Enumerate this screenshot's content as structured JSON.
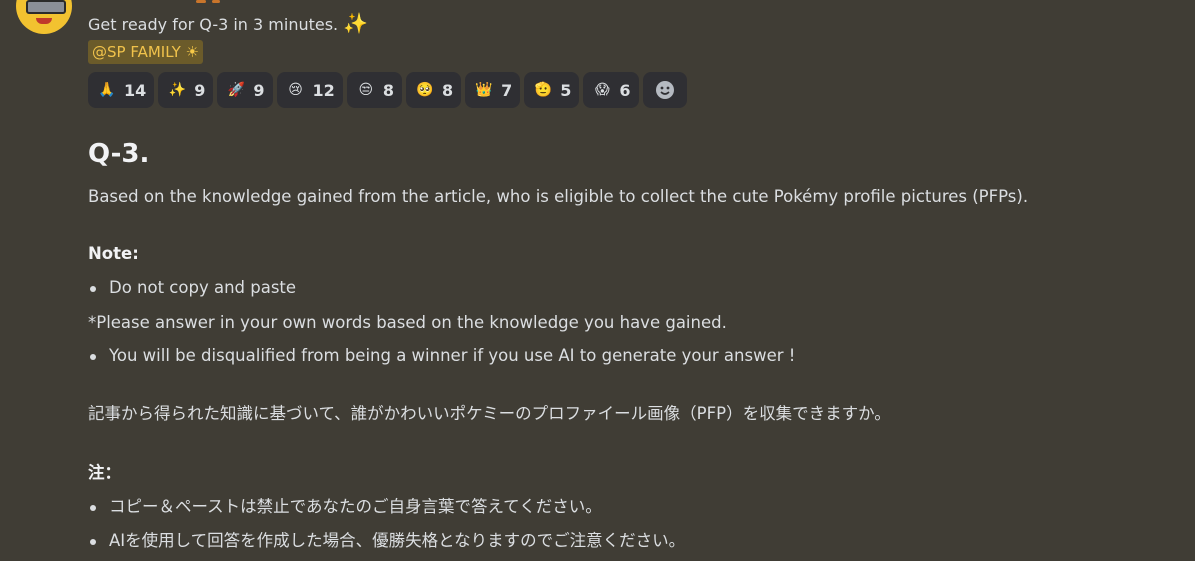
{
  "colors": {
    "background": "#403d35",
    "mention_bg": "#6b5b2a",
    "mention_text": "#f0c24b",
    "reaction_bg": "#2f2f33"
  },
  "message": {
    "line1": "Get ready for Q-3 in 3 minutes.",
    "line1_emoji": "✨",
    "mention": "@SP FAMILY",
    "mention_emoji": "☀"
  },
  "reactions": [
    {
      "icon": "folded-hands-icon",
      "glyph": "🙏",
      "count": "14"
    },
    {
      "icon": "sparkles-icon",
      "glyph": "✨",
      "count": "9"
    },
    {
      "icon": "rocket-icon",
      "glyph": "🚀",
      "count": "9"
    },
    {
      "icon": "crying-face-icon",
      "glyph": "😢",
      "count": "12"
    },
    {
      "icon": "unamused-face-icon",
      "glyph": "😒",
      "count": "8"
    },
    {
      "icon": "pleading-face-icon",
      "glyph": "🥺",
      "count": "8"
    },
    {
      "icon": "crown-icon",
      "glyph": "👑",
      "count": "7"
    },
    {
      "icon": "saluting-face-icon",
      "glyph": "🫡",
      "count": "5"
    },
    {
      "icon": "shocked-face-icon",
      "glyph": "😱",
      "count": "6"
    }
  ],
  "add_reaction_icon": "add-reaction-icon",
  "content": {
    "heading": "Q-3.",
    "question_en": "Based on the knowledge gained from the article, who is eligible to collect the cute Pokémy profile pictures (PFPs).",
    "note_label": "Note:",
    "note_bullet1": "Do not copy and paste",
    "note_line2": "*Please answer in your own words based on the knowledge you have gained.",
    "note_bullet3": "You will be disqualified from being a winner if you use AI to generate your answer !",
    "question_ja": "記事から得られた知識に基づいて、誰がかわいいポケミーのプロファイール画像（PFP）を収集できますか。",
    "note_label_ja": "注：",
    "ja_bullet1": "コピー＆ペーストは禁止であなたのご自身言葉で答えてください。",
    "ja_bullet2": "AIを使用して回答を作成した場合、優勝失格となりますのでご注意ください。"
  }
}
